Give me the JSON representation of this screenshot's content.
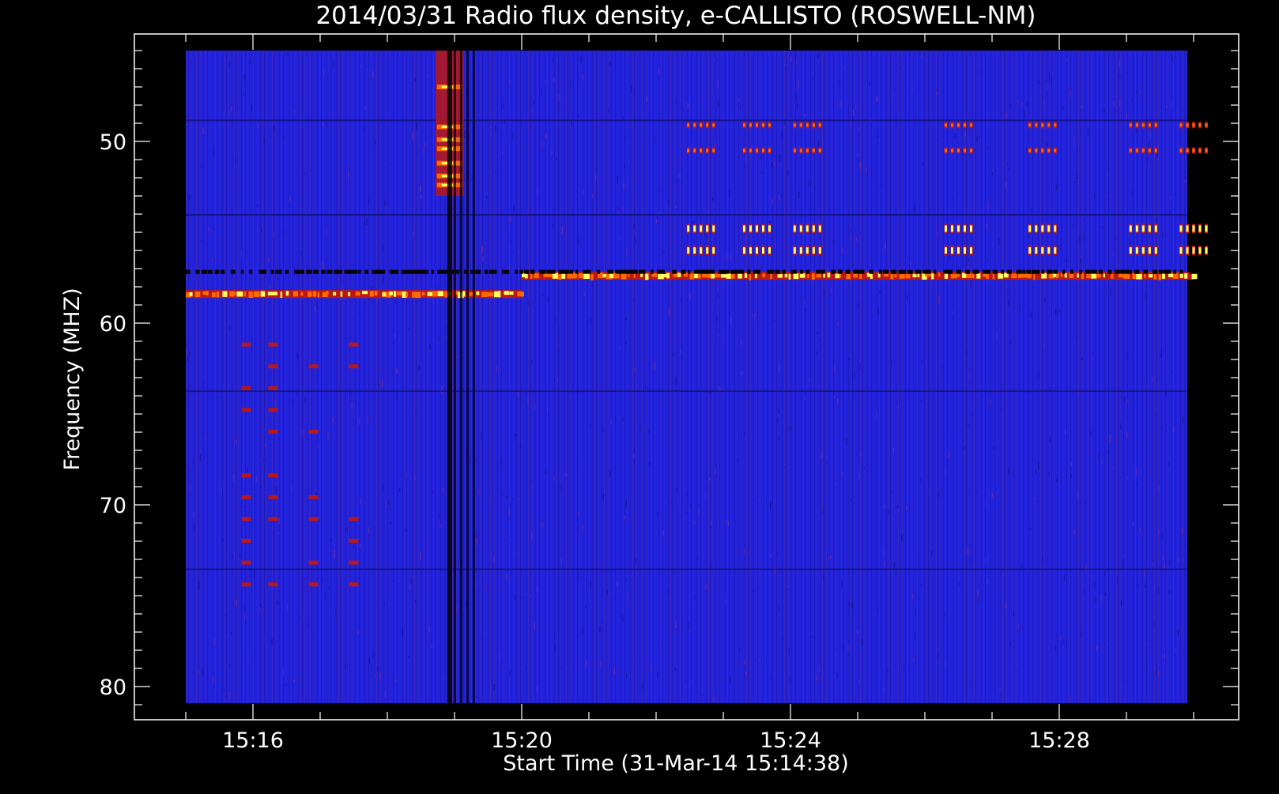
{
  "chart_data": {
    "type": "heatmap",
    "title": "2014/03/31  Radio flux density, e-CALLISTO (ROSWELL-NM)",
    "xlabel": "Start Time (31-Mar-14 15:14:38)",
    "ylabel": "Frequency (MHZ)",
    "x_ticks": [
      "15:16",
      "15:20",
      "15:24",
      "15:28"
    ],
    "y_ticks": [
      "50",
      "60",
      "70",
      "80"
    ],
    "y_axis_inverted": true,
    "data_time_range": [
      "15:15",
      "15:30"
    ],
    "data_freq_range_mhz": [
      45,
      81
    ],
    "colors": {
      "background": "#000000",
      "foreground": "#ffffff",
      "plot_base": "#2424e0",
      "signal_low": "#b81818",
      "signal_mid": "#ff6a00",
      "signal_high": "#ffff60"
    },
    "features": [
      {
        "kind": "horizontal_band",
        "freq_mhz": 58.4,
        "time_range": [
          "15:15",
          "15:20"
        ],
        "note_level": "high"
      },
      {
        "kind": "horizontal_band",
        "freq_mhz": 57.4,
        "time_range": [
          "15:20",
          "15:30"
        ],
        "note_level": "high"
      },
      {
        "kind": "dark_line",
        "freq_mhz": 57.2,
        "time_range": [
          "15:15",
          "15:30"
        ]
      },
      {
        "kind": "burst",
        "time": "15:18:50",
        "freq_range_mhz": [
          45,
          53
        ],
        "note_level": "high"
      },
      {
        "kind": "dark_column",
        "time": "15:18:55",
        "freq_range_mhz": [
          45,
          81
        ]
      },
      {
        "kind": "interference_lines",
        "freqs_mhz": [
          49.1,
          50.5,
          54.8,
          56.0
        ],
        "time_clusters": [
          "15:22:40",
          "15:23:30",
          "15:24:15",
          "15:26:30",
          "15:27:45",
          "15:29:15",
          "15:30:00"
        ]
      }
    ]
  }
}
